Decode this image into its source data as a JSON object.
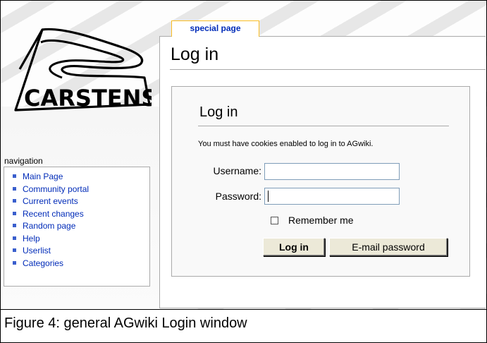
{
  "logo": {
    "text": "CARSTENS"
  },
  "navigation": {
    "title": "navigation",
    "items": [
      {
        "label": "Main Page"
      },
      {
        "label": "Community portal"
      },
      {
        "label": "Current events"
      },
      {
        "label": "Recent changes"
      },
      {
        "label": "Random page"
      },
      {
        "label": "Help"
      },
      {
        "label": "Userlist"
      },
      {
        "label": "Categories"
      }
    ]
  },
  "tab": {
    "label": "special page"
  },
  "page": {
    "title": "Log in"
  },
  "login": {
    "heading": "Log in",
    "cookie_notice": "You must have cookies enabled to log in to AGwiki.",
    "username_label": "Username:",
    "username_value": "",
    "password_label": "Password:",
    "password_value": "",
    "remember_label": "Remember me",
    "remember_checked": false,
    "login_button": "Log in",
    "email_button": "E-mail password"
  },
  "caption": "Figure 4: general AGwiki Login window",
  "colors": {
    "link": "#002bb8",
    "tab_border": "#fabd23",
    "border": "#aaaaaa",
    "button_face": "#ece9d8"
  }
}
